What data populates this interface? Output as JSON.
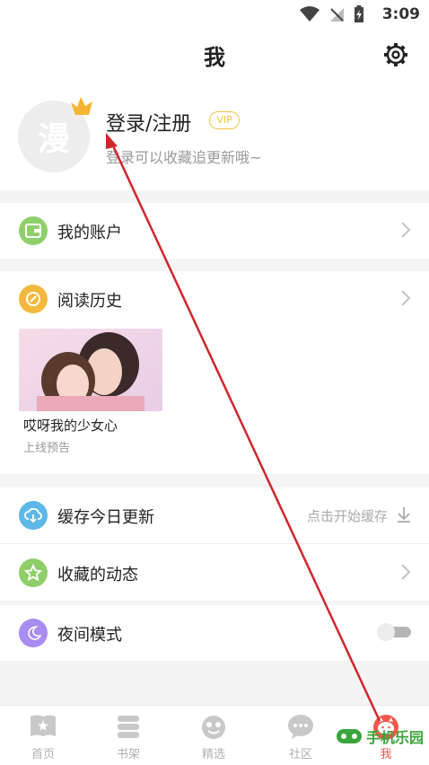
{
  "status": {
    "time": "3:09"
  },
  "header": {
    "title": "我"
  },
  "profile": {
    "avatar_text": "漫",
    "login_label": "登录/注册",
    "vip": "VIP",
    "subtitle": "登录可以收藏追更新哦~"
  },
  "rows": {
    "account": "我的账户",
    "history": "阅读历史",
    "cache": "缓存今日更新",
    "cache_hint": "点击开始缓存",
    "favorites": "收藏的动态",
    "night": "夜间模式"
  },
  "history_item": {
    "title": "哎呀我的少女心",
    "status": "上线预告"
  },
  "tabs": [
    "首页",
    "书架",
    "精选",
    "社区",
    "我"
  ],
  "colors": {
    "accent": "#f2584b",
    "wallet": "#8fcf6a",
    "history": "#f3b93c",
    "cache": "#5db8e8",
    "fav": "#8fcf6a",
    "night": "#a88cf0",
    "arrow": "#d0262d"
  },
  "watermark": "手机乐园"
}
